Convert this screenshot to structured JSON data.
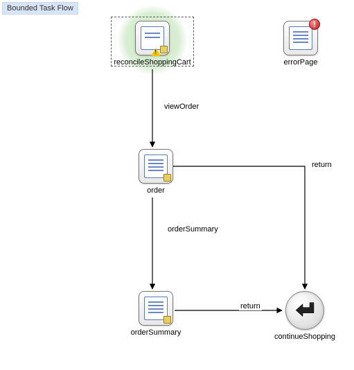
{
  "title": "Bounded Task Flow",
  "nodes": {
    "reconcile": {
      "label": "reconcileShoppingCart"
    },
    "errorPage": {
      "label": "errorPage"
    },
    "order": {
      "label": "order"
    },
    "orderSummary": {
      "label": "orderSummary"
    },
    "continueShopping": {
      "label": "continueShopping"
    }
  },
  "edges": {
    "viewOrder": {
      "label": "viewOrder"
    },
    "orderSummaryEdge": {
      "label": "orderSummary"
    },
    "returnFromOrder": {
      "label": "return"
    },
    "returnFromSummary": {
      "label": "return"
    }
  }
}
